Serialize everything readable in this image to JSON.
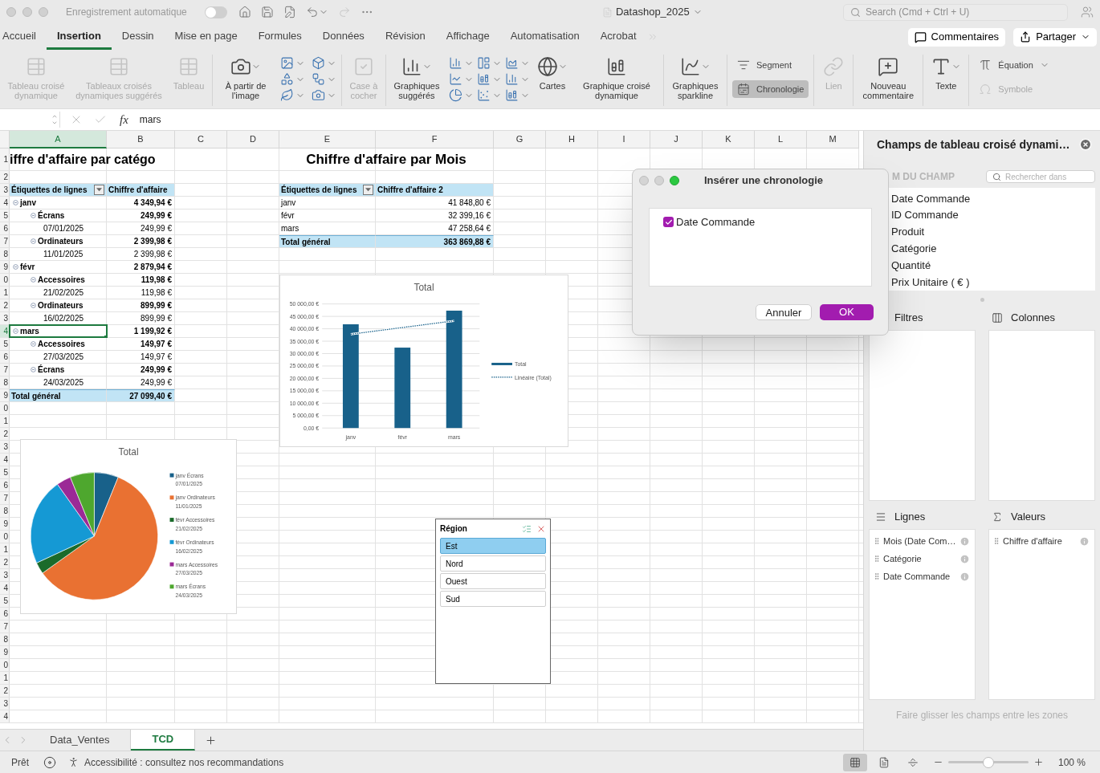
{
  "title_bar": {
    "autosave_label": "Enregistrement automatique",
    "autosave_on": false,
    "document_title": "Datashop_2025",
    "search_placeholder": "Search (Cmd + Ctrl + U)"
  },
  "tabs": [
    {
      "label": "Accueil",
      "selected": false
    },
    {
      "label": "Insertion",
      "selected": true
    },
    {
      "label": "Dessin",
      "selected": false
    },
    {
      "label": "Mise en page",
      "selected": false
    },
    {
      "label": "Formules",
      "selected": false
    },
    {
      "label": "Données",
      "selected": false
    },
    {
      "label": "Révision",
      "selected": false
    },
    {
      "label": "Affichage",
      "selected": false
    },
    {
      "label": "Automatisation",
      "selected": false
    },
    {
      "label": "Acrobat",
      "selected": false
    }
  ],
  "comments_button": "Commentaires",
  "share_button": "Partager",
  "ribbon": {
    "groups": [
      {
        "items": [
          {
            "kind": "large",
            "label": "Tableau croisé dynamique",
            "disabled": true
          },
          {
            "kind": "large",
            "label": "Tableaux croisés dynamiques suggérés",
            "disabled": true
          },
          {
            "kind": "large",
            "label": "Tableau",
            "disabled": true
          }
        ]
      },
      {
        "items": [
          {
            "kind": "large",
            "label": "À partir de l'image",
            "disabled": false
          }
        ]
      },
      {
        "items": [
          {
            "kind": "large",
            "label": "Case à cocher",
            "disabled": true
          }
        ]
      },
      {
        "items": [
          {
            "kind": "large",
            "label": "Graphiques suggérés",
            "disabled": false
          },
          {
            "kind": "large",
            "label": "Cartes",
            "disabled": false
          },
          {
            "kind": "large",
            "label": "Graphique croisé dynamique",
            "disabled": false
          }
        ]
      },
      {
        "items": [
          {
            "kind": "large",
            "label": "Graphiques sparkline",
            "disabled": false
          }
        ]
      },
      {
        "items": [
          {
            "kind": "small",
            "label": "Segment",
            "disabled": false,
            "selected": false
          },
          {
            "kind": "small",
            "label": "Chronologie",
            "disabled": false,
            "selected": true
          }
        ]
      },
      {
        "items": [
          {
            "kind": "large",
            "label": "Lien",
            "disabled": true
          }
        ]
      },
      {
        "items": [
          {
            "kind": "large",
            "label": "Nouveau commentaire",
            "disabled": false
          }
        ]
      },
      {
        "items": [
          {
            "kind": "large",
            "label": "Texte",
            "disabled": false
          }
        ]
      },
      {
        "items": [
          {
            "kind": "small",
            "label": "Équation",
            "disabled": false,
            "selected": false
          },
          {
            "kind": "small",
            "label": "Symbole",
            "disabled": true,
            "selected": false
          }
        ]
      }
    ]
  },
  "formula_bar": {
    "function_label": "fx",
    "value": "mars"
  },
  "sheet": {
    "columns": [
      {
        "label": "A",
        "selected": true
      },
      {
        "label": "B",
        "selected": false
      },
      {
        "label": "C",
        "selected": false
      },
      {
        "label": "D",
        "selected": false
      },
      {
        "label": "E",
        "selected": false
      },
      {
        "label": "F",
        "selected": false
      },
      {
        "label": "G",
        "selected": false
      },
      {
        "label": "H",
        "selected": false
      },
      {
        "label": "I",
        "selected": false
      },
      {
        "label": "J",
        "selected": false
      },
      {
        "label": "K",
        "selected": false
      },
      {
        "label": "L",
        "selected": false
      },
      {
        "label": "M",
        "selected": false
      }
    ],
    "rows": [
      {
        "label": "1",
        "selected": false
      },
      {
        "label": "2",
        "selected": false
      },
      {
        "label": "3",
        "selected": false
      },
      {
        "label": "4",
        "selected": false
      },
      {
        "label": "5",
        "selected": false
      },
      {
        "label": "6",
        "selected": false
      },
      {
        "label": "7",
        "selected": false
      },
      {
        "label": "8",
        "selected": false
      },
      {
        "label": "9",
        "selected": false
      },
      {
        "label": "0",
        "selected": false
      },
      {
        "label": "1",
        "selected": false
      },
      {
        "label": "2",
        "selected": false
      },
      {
        "label": "3",
        "selected": false
      },
      {
        "label": "4",
        "selected": true
      },
      {
        "label": "5",
        "selected": false
      },
      {
        "label": "6",
        "selected": false
      },
      {
        "label": "7",
        "selected": false
      },
      {
        "label": "8",
        "selected": false
      },
      {
        "label": "9",
        "selected": false
      },
      {
        "label": "0",
        "selected": false
      },
      {
        "label": "1",
        "selected": false
      },
      {
        "label": "2",
        "selected": false
      },
      {
        "label": "3",
        "selected": false
      },
      {
        "label": "4",
        "selected": false
      },
      {
        "label": "5",
        "selected": false
      },
      {
        "label": "6",
        "selected": false
      },
      {
        "label": "7",
        "selected": false
      },
      {
        "label": "8",
        "selected": false
      },
      {
        "label": "9",
        "selected": false
      },
      {
        "label": "0",
        "selected": false
      },
      {
        "label": "1",
        "selected": false
      },
      {
        "label": "2",
        "selected": false
      },
      {
        "label": "3",
        "selected": false
      },
      {
        "label": "4",
        "selected": false
      },
      {
        "label": "5",
        "selected": false
      },
      {
        "label": "6",
        "selected": false
      },
      {
        "label": "7",
        "selected": false
      },
      {
        "label": "8",
        "selected": false
      },
      {
        "label": "9",
        "selected": false
      },
      {
        "label": "0",
        "selected": false
      },
      {
        "label": "1",
        "selected": false
      },
      {
        "label": "2",
        "selected": false
      },
      {
        "label": "3",
        "selected": false
      },
      {
        "label": "4",
        "selected": false
      }
    ]
  },
  "pivot_category": {
    "title": "iffre d'affaire par catégo",
    "header": [
      "Étiquettes de lignes",
      "Chiffre d'affaire"
    ],
    "rows": [
      {
        "kind": "group",
        "label": "janv",
        "value": "4 349,94 €",
        "selected": false
      },
      {
        "kind": "subgroup",
        "label": "Écrans",
        "value": "249,99 €",
        "selected": false
      },
      {
        "kind": "item",
        "label": "07/01/2025",
        "value": "249,99 €",
        "selected": false
      },
      {
        "kind": "subgroup",
        "label": "Ordinateurs",
        "value": "2 399,98 €",
        "selected": false
      },
      {
        "kind": "item",
        "label": "11/01/2025",
        "value": "2 399,98 €",
        "selected": false
      },
      {
        "kind": "group",
        "label": "févr",
        "value": "2 879,94 €",
        "selected": false
      },
      {
        "kind": "subgroup",
        "label": "Accessoires",
        "value": "119,98 €",
        "selected": false
      },
      {
        "kind": "item",
        "label": "21/02/2025",
        "value": "119,98 €",
        "selected": false
      },
      {
        "kind": "subgroup",
        "label": "Ordinateurs",
        "value": "899,99 €",
        "selected": false
      },
      {
        "kind": "item",
        "label": "16/02/2025",
        "value": "899,99 €",
        "selected": false
      },
      {
        "kind": "group",
        "label": "mars",
        "value": "1 199,92 €",
        "selected": true
      },
      {
        "kind": "subgroup",
        "label": "Accessoires",
        "value": "149,97 €",
        "selected": false
      },
      {
        "kind": "item",
        "label": "27/03/2025",
        "value": "149,97 €",
        "selected": false
      },
      {
        "kind": "subgroup",
        "label": "Écrans",
        "value": "249,99 €",
        "selected": false
      },
      {
        "kind": "item",
        "label": "24/03/2025",
        "value": "249,99 €",
        "selected": false
      }
    ],
    "total": {
      "label": "Total général",
      "value": "27 099,40 €"
    }
  },
  "pivot_month": {
    "title": "Chiffre d'affaire par Mois",
    "header": [
      "Étiquettes de lignes",
      "Chiffre d'affaire 2"
    ],
    "rows": [
      {
        "label": "janv",
        "value": "41 848,80 €"
      },
      {
        "label": "févr",
        "value": "32 399,16 €"
      },
      {
        "label": "mars",
        "value": "47 258,64 €"
      }
    ],
    "total": {
      "label": "Total général",
      "value": "363 869,88 €"
    }
  },
  "bar_chart": {
    "chart_data": {
      "type": "bar",
      "title": "Total",
      "categories": [
        "janv",
        "févr",
        "mars"
      ],
      "series": [
        {
          "name": "Total",
          "color": "#18618a",
          "values": [
            41800,
            32400,
            47300
          ]
        },
        {
          "name": "Linéaire (Total)",
          "type": "line",
          "line_style": "dotted",
          "color": "#18618a",
          "values": [
            37800,
            40500,
            43200
          ]
        }
      ],
      "stacked": false,
      "legend": "right",
      "grid": true,
      "ylim": [
        0,
        50000
      ],
      "yticks": [
        {
          "value": 0,
          "label": "0,00 €"
        },
        {
          "value": 5000,
          "label": "5 000,00 €"
        },
        {
          "value": 10000,
          "label": "10 000,00 €"
        },
        {
          "value": 15000,
          "label": "15 000,00 €"
        },
        {
          "value": 20000,
          "label": "20 000,00 €"
        },
        {
          "value": 25000,
          "label": "25 000,00 €"
        },
        {
          "value": 30000,
          "label": "30 000,00 €"
        },
        {
          "value": 35000,
          "label": "35 000,00 €"
        },
        {
          "value": 40000,
          "label": "40 000,00 €"
        },
        {
          "value": 45000,
          "label": "45 000,00 €"
        },
        {
          "value": 50000,
          "label": "50 000,00 €"
        }
      ]
    }
  },
  "pie_chart": {
    "chart_data": {
      "type": "pie",
      "title": "Total",
      "legend": "right",
      "categories": [
        "janv Écrans 07/01/2025",
        "janv Ordinateurs 11/01/2025",
        "févr Accessoires 21/02/2025",
        "févr Ordinateurs 16/02/2025",
        "mars Accessoires 27/03/2025",
        "mars Écrans 24/03/2025"
      ],
      "series": [
        {
          "values": [
            6.14,
            58.98,
            2.95,
            22.11,
            3.68,
            6.14
          ],
          "colors": [
            "#18618a",
            "#e97132",
            "#1b6b2b",
            "#1599d4",
            "#9b2a96",
            "#4ea72e"
          ]
        }
      ]
    }
  },
  "slicer": {
    "title": "Région",
    "items": [
      {
        "label": "Est",
        "selected": true
      },
      {
        "label": "Nord",
        "selected": false
      },
      {
        "label": "Ouest",
        "selected": false
      },
      {
        "label": "Sud",
        "selected": false
      }
    ]
  },
  "dialog": {
    "title": "Insérer une chronologie",
    "options": [
      {
        "label": "Date Commande",
        "checked": true
      }
    ],
    "buttons": [
      {
        "label": "Annuler",
        "kind": "secondary"
      },
      {
        "label": "OK",
        "kind": "primary"
      }
    ]
  },
  "field_panel": {
    "title": "Champs de tableau croisé dynami…",
    "field_header": "M DU CHAMP",
    "search_placeholder": "Rechercher dans",
    "fields": [
      "Date Commande",
      "ID Commande",
      "Produit",
      "Catégorie",
      "Quantité",
      "Prix Unitaire ( € )"
    ],
    "areas": [
      {
        "kind": "filters",
        "label": "Filtres"
      },
      {
        "kind": "columns",
        "label": "Colonnes"
      },
      {
        "kind": "rows",
        "label": "Lignes",
        "items": [
          "Mois (Date Com…",
          "Catégorie",
          "Date Commande"
        ]
      },
      {
        "kind": "values",
        "label": "Valeurs",
        "items": [
          "Chiffre d'affaire"
        ]
      }
    ],
    "hint": "Faire glisser les champs entre les zones"
  },
  "sheet_tabs": [
    {
      "label": "Data_Ventes",
      "selected": false
    },
    {
      "label": "TCD",
      "selected": true
    }
  ],
  "status_bar": {
    "status": "Prêt",
    "accessibility": "Accessibilité : consultez nos recommandations",
    "views": [
      {
        "selected": true
      },
      {
        "selected": false
      },
      {
        "selected": false
      }
    ],
    "zoom": {
      "level": 0.5,
      "reading": "100 %"
    }
  }
}
